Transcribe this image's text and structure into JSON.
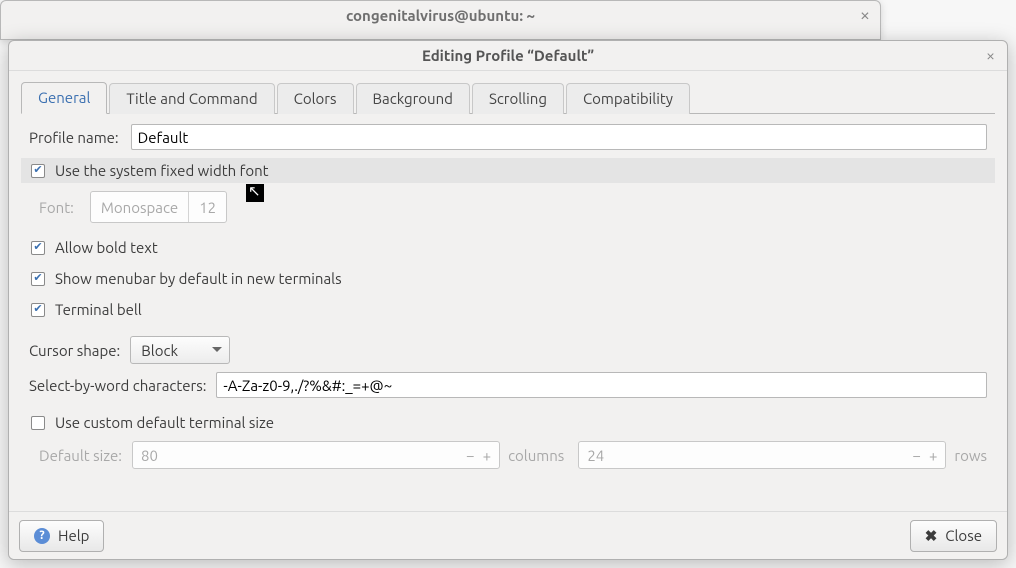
{
  "backWindow": {
    "title": "congenitalvirus@ubuntu: ~"
  },
  "dialog": {
    "title": "Editing Profile “Default”"
  },
  "tabs": {
    "general": "General",
    "titlecmd": "Title and Command",
    "colors": "Colors",
    "background": "Background",
    "scrolling": "Scrolling",
    "compat": "Compatibility"
  },
  "general": {
    "profileNameLabel": "Profile name:",
    "profileNameValue": "Default",
    "useSystemFont": "Use the system fixed width font",
    "fontLabel": "Font:",
    "fontName": "Monospace",
    "fontSize": "12",
    "allowBold": "Allow bold text",
    "showMenubar": "Show menubar by default in new terminals",
    "terminalBell": "Terminal bell",
    "cursorShapeLabel": "Cursor shape:",
    "cursorShapeValue": "Block",
    "selectByWordLabel": "Select-by-word characters:",
    "selectByWordValue": "-A-Za-z0-9,./?%&#:_=+@~",
    "useCustomSize": "Use custom default terminal size",
    "defaultSizeLabel": "Default size:",
    "cols": "80",
    "colsUnit": "columns",
    "rows": "24",
    "rowsUnit": "rows"
  },
  "footer": {
    "help": "Help",
    "close": "Close"
  }
}
